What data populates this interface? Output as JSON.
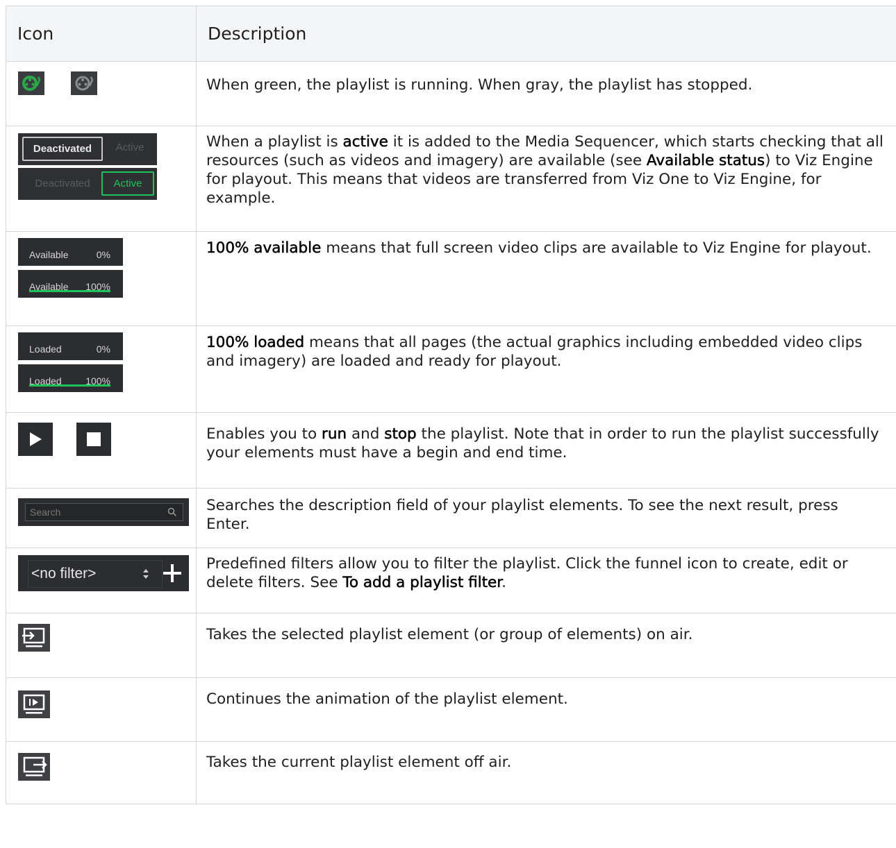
{
  "table": {
    "headers": {
      "icon": "Icon",
      "description": "Description"
    },
    "rows": [
      {
        "icons": [
          "playlist-running-icon",
          "playlist-stopped-icon"
        ],
        "colors": {
          "running": "#2ba84a",
          "stopped": "#6d6f72"
        },
        "description": [
          "When green, the playlist is running. When gray, the playlist has stopped."
        ]
      },
      {
        "toggle": {
          "deactivated_label": "Deactivated",
          "active_label": "Active",
          "active_color": "#21c25b"
        },
        "description": [
          "When a playlist is ",
          "active",
          " it is added to the Media Sequencer, which starts checking that all resources (such as videos and imagery) are available (see ",
          "Available status",
          ") to Viz Engine for playout. This means that videos are transferred from Viz One to Viz Engine, for example."
        ]
      },
      {
        "status": {
          "label": "Available",
          "low": "0%",
          "high": "100%",
          "low_fraction": 0,
          "high_fraction": 1
        },
        "description": [
          "100% available",
          " means that full screen video clips are available to Viz Engine for playout."
        ]
      },
      {
        "status": {
          "label": "Loaded",
          "low": "0%",
          "high": "100%",
          "low_fraction": 0,
          "high_fraction": 1
        },
        "description": [
          "100% loaded",
          " means that all pages (the actual graphics including embedded video clips and imagery) are loaded and ready for playout."
        ]
      },
      {
        "icons": [
          "play-icon",
          "stop-icon"
        ],
        "description": [
          "Enables you to ",
          "run",
          " and ",
          "stop",
          " the playlist. Note that in order to run the playlist successfully your elements must have a begin and end time."
        ]
      },
      {
        "search": {
          "placeholder": "Search",
          "icon": "search-icon"
        },
        "description": [
          "Searches the description field of your playlist elements. To see the next result, press Enter."
        ]
      },
      {
        "filter": {
          "value": "<no filter>",
          "icons": [
            "updown-arrows-icon",
            "plus-icon"
          ]
        },
        "description": [
          "Predefined filters allow you to filter the playlist. Click the funnel icon to create, edit or delete filters. See ",
          "To add a playlist filter",
          "."
        ]
      },
      {
        "icons": [
          "take-on-air-icon"
        ],
        "description": [
          "Takes the selected playlist element (or group of elements) on air."
        ]
      },
      {
        "icons": [
          "continue-icon"
        ],
        "description": [
          "Continues the animation of the playlist element."
        ]
      },
      {
        "icons": [
          "take-off-air-icon"
        ],
        "description": [
          "Takes the current playlist element off air."
        ]
      }
    ]
  }
}
